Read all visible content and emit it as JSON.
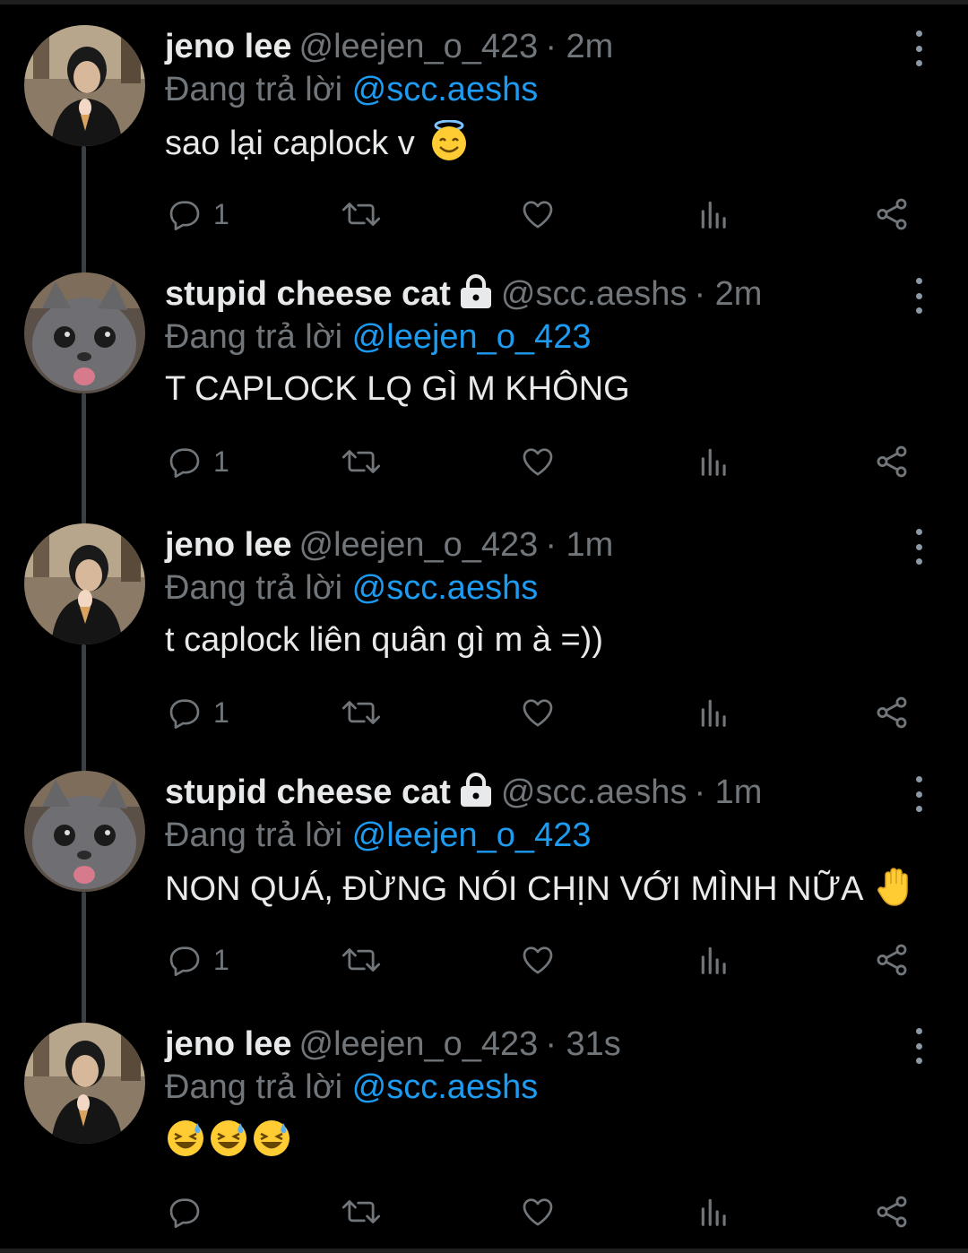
{
  "colors": {
    "accent": "#1d9bf0",
    "muted": "#71767b",
    "text": "#e7e9ea",
    "background": "#000000"
  },
  "icons": [
    "reply-icon",
    "retweet-icon",
    "like-icon",
    "views-icon",
    "share-icon",
    "more-icon",
    "lock-icon"
  ],
  "tweets": [
    {
      "name": "jeno lee",
      "handle": "@leejen_o_423",
      "time": "· 2m",
      "replying_prefix": "Đang trả lời",
      "replying_to": "@scc.aeshs",
      "text": "sao lại caplock v",
      "emoji": "smiling-face-with-halo",
      "locked": false,
      "avatar": "person",
      "reply_count": "1"
    },
    {
      "name": "stupid cheese cat",
      "handle": "@scc.aeshs",
      "time": "· 2m",
      "replying_prefix": "Đang trả lời",
      "replying_to": "@leejen_o_423",
      "text": "T CAPLOCK LQ GÌ M KHÔNG",
      "emoji": "",
      "locked": true,
      "avatar": "cat",
      "reply_count": "1"
    },
    {
      "name": "jeno lee",
      "handle": "@leejen_o_423",
      "time": "· 1m",
      "replying_prefix": "Đang trả lời",
      "replying_to": "@scc.aeshs",
      "text": "t caplock liên quân gì m à =))",
      "emoji": "",
      "locked": false,
      "avatar": "person",
      "reply_count": "1"
    },
    {
      "name": "stupid cheese cat",
      "handle": "@scc.aeshs",
      "time": "· 1m",
      "replying_prefix": "Đang trả lời",
      "replying_to": "@leejen_o_423",
      "text": "NON QUÁ, ĐỪNG NÓI CHỊN VỚI MÌNH NỮA",
      "emoji": "raised-hand",
      "locked": true,
      "avatar": "cat",
      "reply_count": "1"
    },
    {
      "name": "jeno lee",
      "handle": "@leejen_o_423",
      "time": "· 31s",
      "replying_prefix": "Đang trả lời",
      "replying_to": "@scc.aeshs",
      "text": "",
      "emoji": "grinning-face-with-sweat x3",
      "locked": false,
      "avatar": "person",
      "reply_count": ""
    }
  ]
}
